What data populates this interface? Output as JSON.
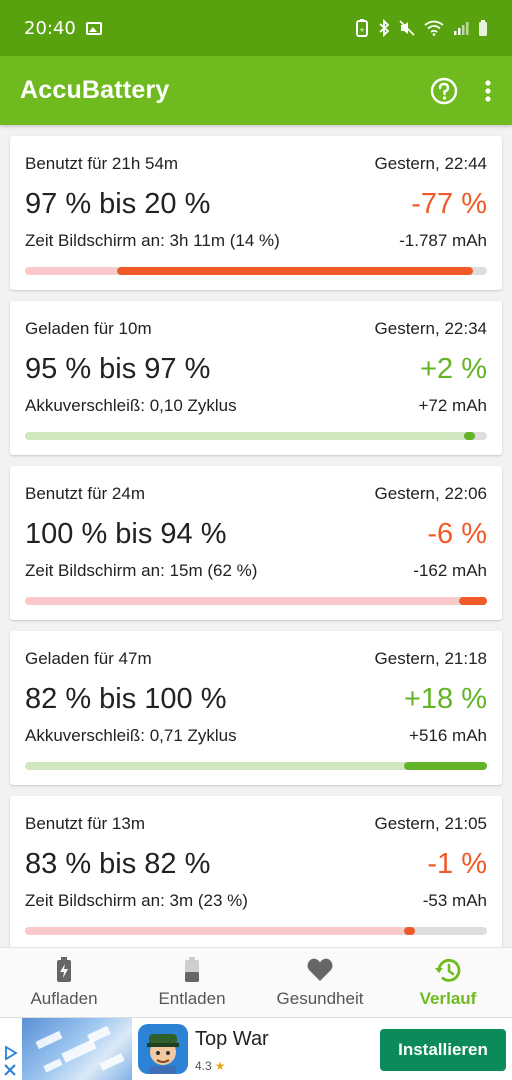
{
  "status_bar": {
    "time": "20:40"
  },
  "app_bar": {
    "title": "AccuBattery"
  },
  "colors": {
    "accent": "#6fbb1f",
    "status_bar": "#58a20f",
    "negative": "#f05a28",
    "positive": "#62b426"
  },
  "sessions": [
    {
      "kind": "discharge",
      "duration": "Benutzt für 21h 54m",
      "time": "Gestern, 22:44",
      "range": "97 % bis 20 %",
      "delta": "-77 %",
      "detail": "Zeit Bildschirm an: 3h 11m (14 %)",
      "mah": "-1.787 mAh",
      "bar_from_pct": 20,
      "bar_to_pct": 97
    },
    {
      "kind": "charge",
      "duration": "Geladen für 10m",
      "time": "Gestern, 22:34",
      "range": "95 % bis 97 %",
      "delta": "+2 %",
      "detail": "Akkuverschleiß: 0,10 Zyklus",
      "mah": "+72 mAh",
      "bar_from_pct": 95,
      "bar_to_pct": 97
    },
    {
      "kind": "discharge",
      "duration": "Benutzt für 24m",
      "time": "Gestern, 22:06",
      "range": "100 % bis 94 %",
      "delta": "-6 %",
      "detail": "Zeit Bildschirm an: 15m (62 %)",
      "mah": "-162 mAh",
      "bar_from_pct": 94,
      "bar_to_pct": 100
    },
    {
      "kind": "charge",
      "duration": "Geladen für 47m",
      "time": "Gestern, 21:18",
      "range": "82 % bis 100 %",
      "delta": "+18 %",
      "detail": "Akkuverschleiß: 0,71 Zyklus",
      "mah": "+516 mAh",
      "bar_from_pct": 82,
      "bar_to_pct": 100
    },
    {
      "kind": "discharge",
      "duration": "Benutzt für 13m",
      "time": "Gestern, 21:05",
      "range": "83 % bis 82 %",
      "delta": "-1 %",
      "detail": "Zeit Bildschirm an: 3m (23 %)",
      "mah": "-53 mAh",
      "bar_from_pct": 82,
      "bar_to_pct": 83
    }
  ],
  "bottom_nav": [
    {
      "label": "Aufladen",
      "icon": "battery-charging-icon",
      "active": false
    },
    {
      "label": "Entladen",
      "icon": "battery-discharging-icon",
      "active": false
    },
    {
      "label": "Gesundheit",
      "icon": "heart-icon",
      "active": false
    },
    {
      "label": "Verlauf",
      "icon": "history-icon",
      "active": true
    }
  ],
  "ad": {
    "title": "Top War",
    "rating": "4.3",
    "button_label": "Installieren"
  }
}
